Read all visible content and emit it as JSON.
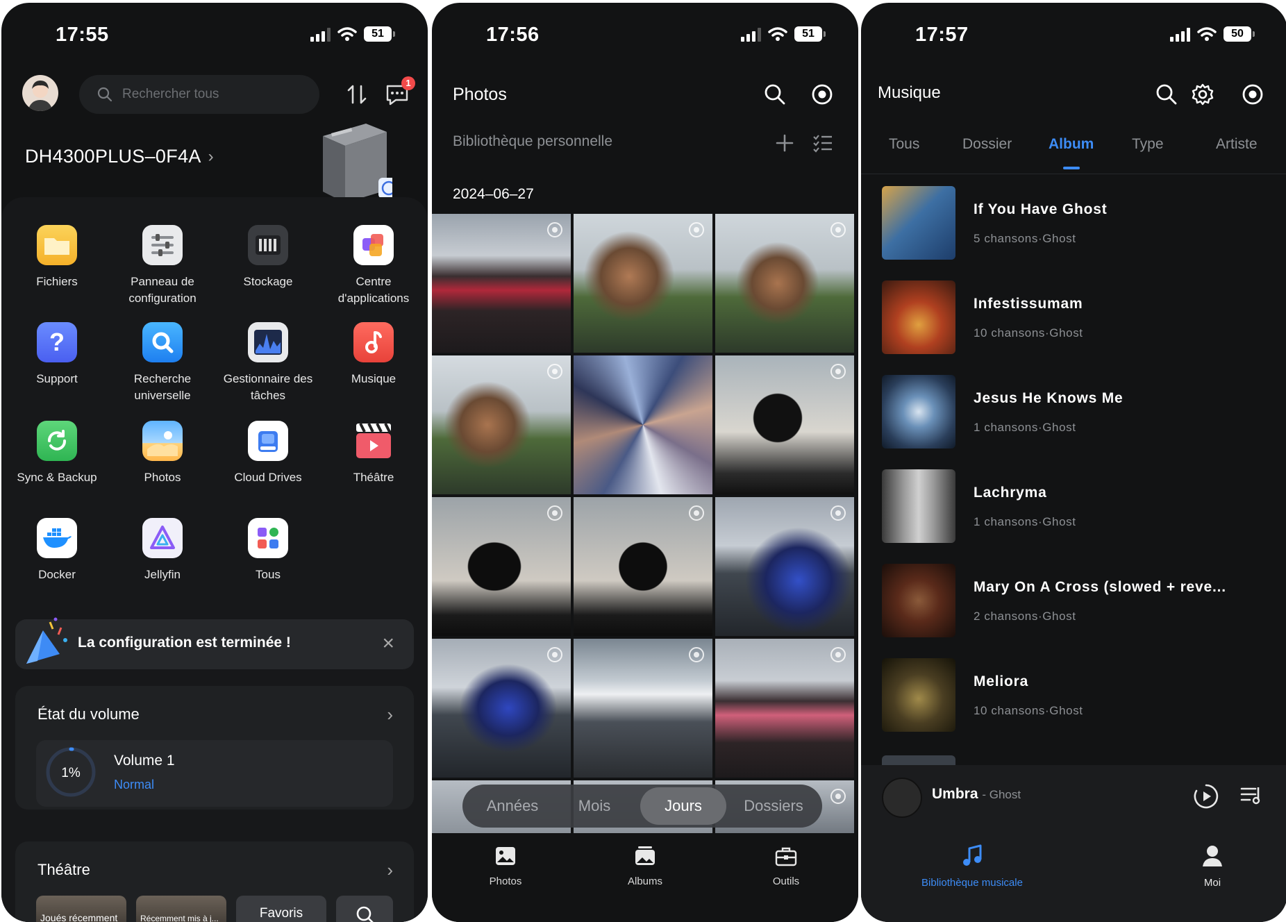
{
  "screens": [
    {
      "status": {
        "time": "17:55",
        "battery": "51"
      },
      "search_placeholder": "Rechercher tous",
      "notification_count": "1",
      "device_name": "DH4300PLUS–0F4A",
      "apps": [
        {
          "label": "Fichiers"
        },
        {
          "label": "Panneau de configuration"
        },
        {
          "label": "Stockage"
        },
        {
          "label": "Centre d'applications"
        },
        {
          "label": "Support"
        },
        {
          "label": "Recherche universelle"
        },
        {
          "label": "Gestionnaire des tâches"
        },
        {
          "label": "Musique"
        },
        {
          "label": "Sync & Backup"
        },
        {
          "label": "Photos"
        },
        {
          "label": "Cloud Drives"
        },
        {
          "label": "Théâtre"
        },
        {
          "label": "Docker"
        },
        {
          "label": "Jellyfin"
        },
        {
          "label": "Tous"
        }
      ],
      "banner": {
        "text": "La configuration est terminée !"
      },
      "volume_card": {
        "title": "État du volume",
        "percent": "1%",
        "percent_value": 1,
        "name": "Volume 1",
        "status": "Normal"
      },
      "theatre_card": {
        "title": "Théâtre",
        "items": [
          "Joués récemment",
          "Récemment mis à j...",
          "Favoris"
        ]
      }
    },
    {
      "status": {
        "time": "17:56",
        "battery": "51"
      },
      "title": "Photos",
      "library": "Bibliothèque personnelle",
      "date": "2024–06–27",
      "segments": [
        "Années",
        "Mois",
        "Jours",
        "Dossiers"
      ],
      "active_segment": "Jours",
      "tabs": [
        "Photos",
        "Albums",
        "Outils"
      ]
    },
    {
      "status": {
        "time": "17:57",
        "battery": "50"
      },
      "title": "Musique",
      "tabs": [
        "Tous",
        "Dossier",
        "Album",
        "Type",
        "Artiste"
      ],
      "active_tab": "Album",
      "albums": [
        {
          "name": "If You Have Ghost",
          "meta": "5 chansons·Ghost"
        },
        {
          "name": "Infestissumam",
          "meta": "10 chansons·Ghost"
        },
        {
          "name": "Jesus He Knows Me",
          "meta": "1 chansons·Ghost"
        },
        {
          "name": "Lachryma",
          "meta": "1 chansons·Ghost"
        },
        {
          "name": "Mary On A Cross (slowed + reve...",
          "meta": "2 chansons·Ghost"
        },
        {
          "name": "Meliora",
          "meta": "10 chansons·Ghost"
        }
      ],
      "now_playing": {
        "title": "Umbra",
        "artist": "- Ghost"
      },
      "bottom_tabs": [
        "Bibliothèque musicale",
        "Moi"
      ],
      "colors": {
        "accent": "#3d8cf6"
      }
    }
  ]
}
